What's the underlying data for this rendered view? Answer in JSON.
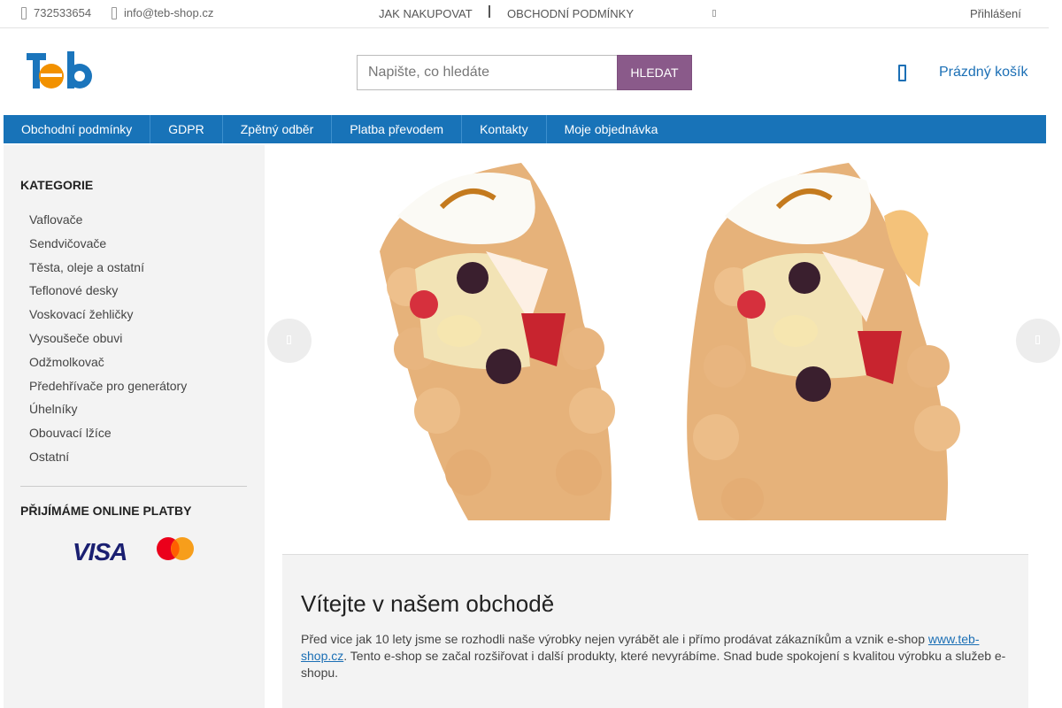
{
  "topbar": {
    "phone": "732533654",
    "email": "info@teb-shop.cz",
    "links": [
      "JAK NAKUPOVAT",
      "OBCHODNÍ PODMÍNKY"
    ],
    "login": "Přihlášení"
  },
  "header": {
    "search_placeholder": "Napište, co hledáte",
    "search_button": "HLEDAT",
    "cart_label": "Prázdný košík",
    "colors": {
      "brand_blue": "#1873b8",
      "logo_orange": "#f29100",
      "search_button": "#8a5a8a"
    }
  },
  "nav": {
    "items": [
      "Obchodní podmínky",
      "GDPR",
      "Zpětný odběr",
      "Platba převodem",
      "Kontakty",
      "Moje objednávka"
    ]
  },
  "sidebar": {
    "categories_title": "KATEGORIE",
    "categories": [
      "Vaflovače",
      "Sendvičovače",
      "Těsta, oleje a ostatní",
      "Teflonové desky",
      "Voskovací žehličky",
      "Vysoušeče obuvi",
      "Odžmolkovač",
      "Předehřívače pro generátory",
      "Úhelníky",
      "Obouvací lžíce",
      "Ostatní"
    ],
    "payments_title": "PŘIJÍMÁME ONLINE PLATBY",
    "visa": "VISA"
  },
  "content": {
    "title": "Vítejte v našem obchodě",
    "text_before": "Před vice jak 10 lety jsme se rozhodli naše výrobky nejen vyrábět ale i přímo prodávat zákazníkům a vznik e-shop ",
    "link": "www.teb-shop.cz",
    "text_after": ". Tento e-shop se začal rozšiřovat i další produkty, které nevyrábíme. Snad bude spokojení s kvalitou výrobku a služeb e-shopu."
  }
}
